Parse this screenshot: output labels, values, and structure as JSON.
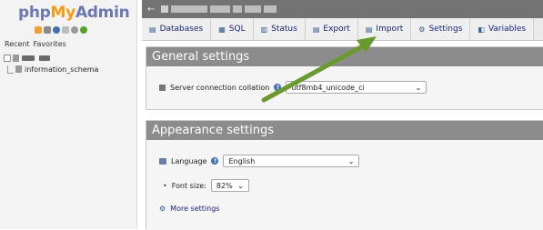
{
  "sidebar": {
    "logo": {
      "php": "php",
      "my": "My",
      "admin": "Admin"
    },
    "icons": [
      "home-icon",
      "exit-icon",
      "help-icon",
      "docs-icon",
      "settings-icon",
      "reload-icon"
    ],
    "recent_label": "Recent",
    "favorites_label": "Favorites",
    "tree": [
      {
        "label": "",
        "blurred": true
      },
      {
        "label": "information_schema",
        "blurred": false
      }
    ]
  },
  "topbar": {
    "back_arrow": "←"
  },
  "tabs": [
    {
      "label": "Databases",
      "icon": "▤"
    },
    {
      "label": "SQL",
      "icon": "▦"
    },
    {
      "label": "Status",
      "icon": "▥"
    },
    {
      "label": "Export",
      "icon": "▤"
    },
    {
      "label": "Import",
      "icon": "▤"
    },
    {
      "label": "Settings",
      "icon": "⚙"
    },
    {
      "label": "Variables",
      "icon": "◧"
    }
  ],
  "general": {
    "title": "General settings",
    "collation_label": "Server connection collation",
    "collation_value": "utf8mb4_unicode_ci"
  },
  "appearance": {
    "title": "Appearance settings",
    "language_label": "Language",
    "language_value": "English",
    "font_size_label": "Font size:",
    "font_size_value": "82%",
    "more_settings": "More settings"
  },
  "colors": {
    "arrow": "#6a9a2f",
    "panel_header": "#8c8c8c",
    "link": "#1a237e"
  }
}
